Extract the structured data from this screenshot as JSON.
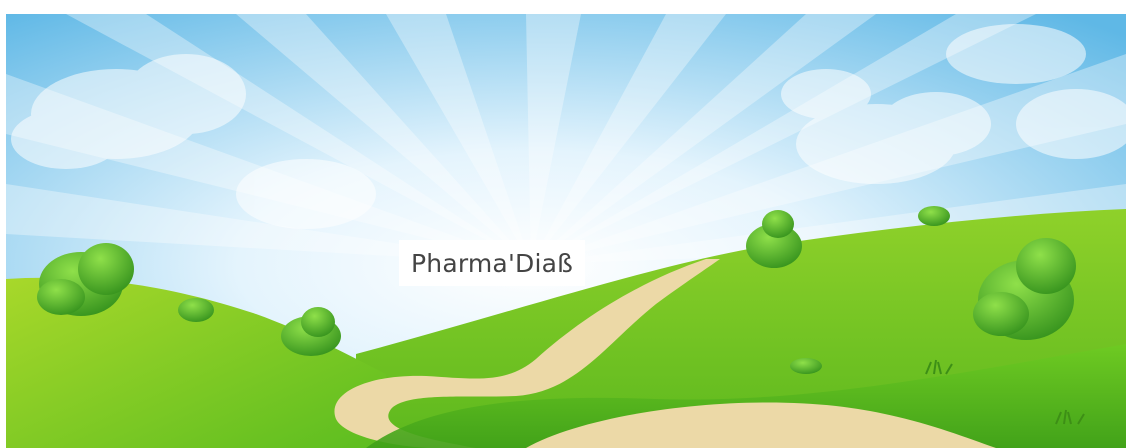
{
  "banner": {
    "title": "Pharma'Diaß",
    "scene": "sunny-hills-landscape"
  },
  "colors": {
    "sky_top": "#5fb8e6",
    "sky_center": "#ffffff",
    "cloud": "#d9eef9",
    "hill_light": "#9ed62c",
    "hill_mid": "#6cc51f",
    "hill_dark": "#46a51a",
    "path": "#ecd9a7",
    "bush": "#4caf25",
    "title_text": "#444444",
    "title_bg": "#ffffff"
  }
}
